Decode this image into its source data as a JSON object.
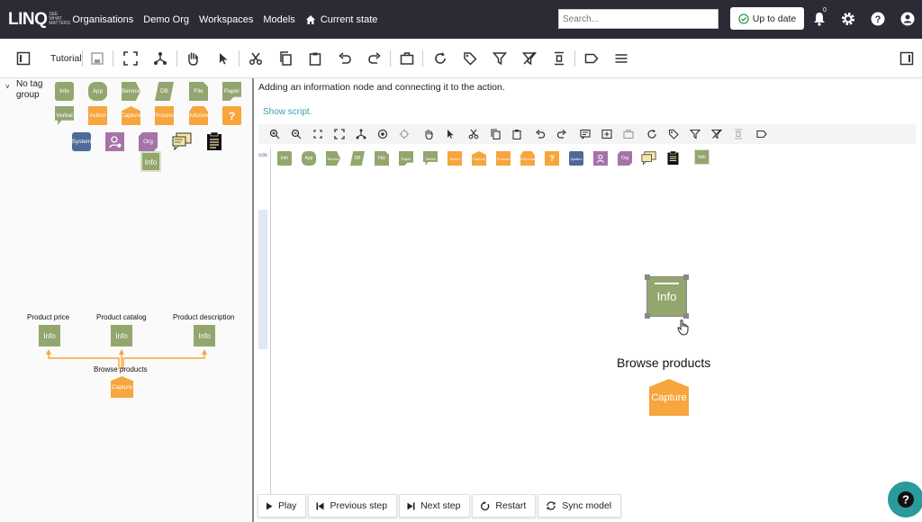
{
  "header": {
    "logo": "LINQ",
    "logo_sub": "SEE WHAT MATTERS",
    "nav": [
      "Organisations",
      "Demo Org",
      "Workspaces",
      "Models",
      "Current state"
    ],
    "search_placeholder": "Search...",
    "status_button": "Up to date",
    "notification_count": "0"
  },
  "toolbar": {
    "tutorial_label": "Tutorial"
  },
  "left_panel": {
    "group_label": "No tag group",
    "palette": [
      "Info",
      "App",
      "Service",
      "DB",
      "File",
      "Paper",
      "Verbal",
      "Action",
      "Capture",
      "Process",
      "Outcome",
      "?",
      "System",
      "",
      "Org",
      "",
      "",
      "Info"
    ],
    "diagram": {
      "labels": [
        "Product price",
        "Product catalog",
        "Product description",
        "Browse products"
      ],
      "nodes": [
        "Info",
        "Info",
        "Info",
        "Capture"
      ]
    }
  },
  "tutorial": {
    "instruction": "Adding an information node and connecting it to the action.",
    "show_script": "Show script."
  },
  "canvas": {
    "side_label": "ode",
    "palette": [
      "Info",
      "App",
      "Service",
      "DB",
      "File",
      "Paper",
      "Verbal",
      "Action",
      "Capture",
      "Process",
      "Outcome",
      "?",
      "System",
      "",
      "Org",
      "",
      "",
      "Info"
    ],
    "info_node": "Info",
    "action_label": "Browse products",
    "capture_node": "Capture"
  },
  "controls": [
    "Play",
    "Previous step",
    "Next step",
    "Restart",
    "Sync model"
  ],
  "colors": {
    "topbar": "#2b2b36",
    "info_green": "#93a66e",
    "action_orange": "#f7a53d",
    "system_blue": "#4d6b96",
    "person_purple": "#a673a8",
    "fab_teal": "#2a9a9a"
  }
}
